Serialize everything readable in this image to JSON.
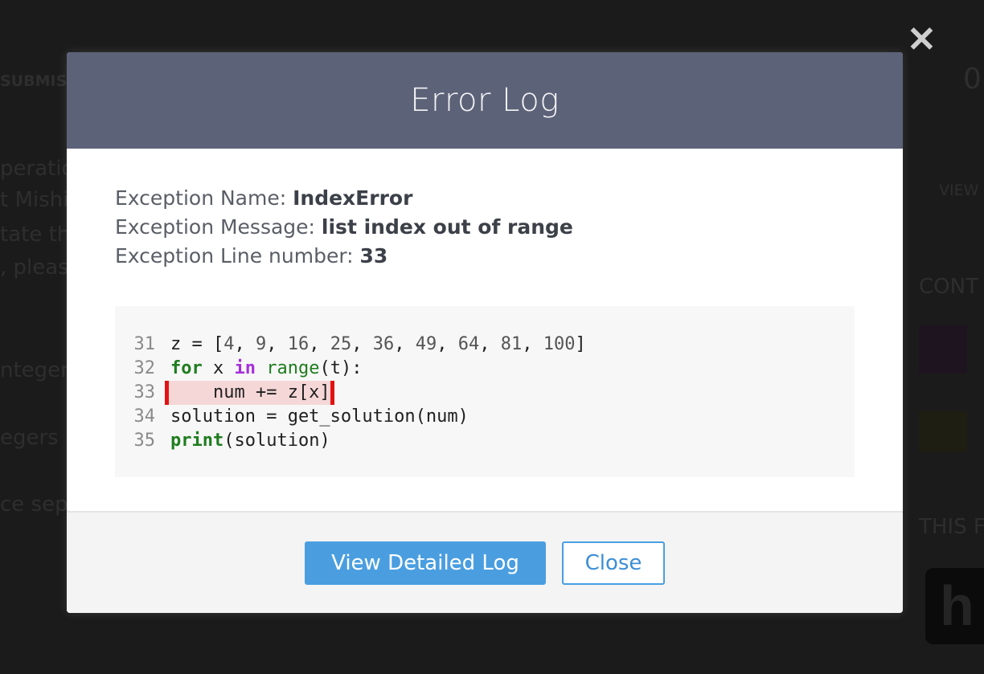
{
  "background": {
    "submissions_label": "SUBMIS",
    "text_fragments": [
      "peratio",
      "t Mishi",
      "tate th",
      ", please",
      "nteger",
      "egers",
      "ce sepa"
    ],
    "right_fragments": [
      "0",
      "VIEW",
      "CONT",
      "THIS F"
    ],
    "logo_letter": "h"
  },
  "modal": {
    "title": "Error Log",
    "exception_name_label": "Exception Name: ",
    "exception_name": "IndexError",
    "exception_message_label": "Exception Message: ",
    "exception_message": "list index out of range",
    "exception_line_label": "Exception Line number: ",
    "exception_line": "33",
    "code_lines": [
      {
        "number": "31",
        "text": "z = [4, 9, 16, 25, 36, 49, 64, 81, 100]"
      },
      {
        "number": "32",
        "text": "for x in range(t):"
      },
      {
        "number": "33",
        "text": "    num += z[x]",
        "highlighted": true
      },
      {
        "number": "34",
        "text": "solution = get_solution(num)"
      },
      {
        "number": "35",
        "text": "print(solution)"
      }
    ],
    "buttons": {
      "view_detailed_log": "View Detailed Log",
      "close": "Close"
    },
    "close_icon": "close-icon"
  },
  "colors": {
    "header_bg": "#5c6278",
    "primary_button": "#4a9ee0",
    "highlight_border": "#e31212",
    "highlight_bg": "#f6d7d7",
    "keyword_green": "#1f7d1f",
    "keyword_purple": "#a52fd9"
  }
}
